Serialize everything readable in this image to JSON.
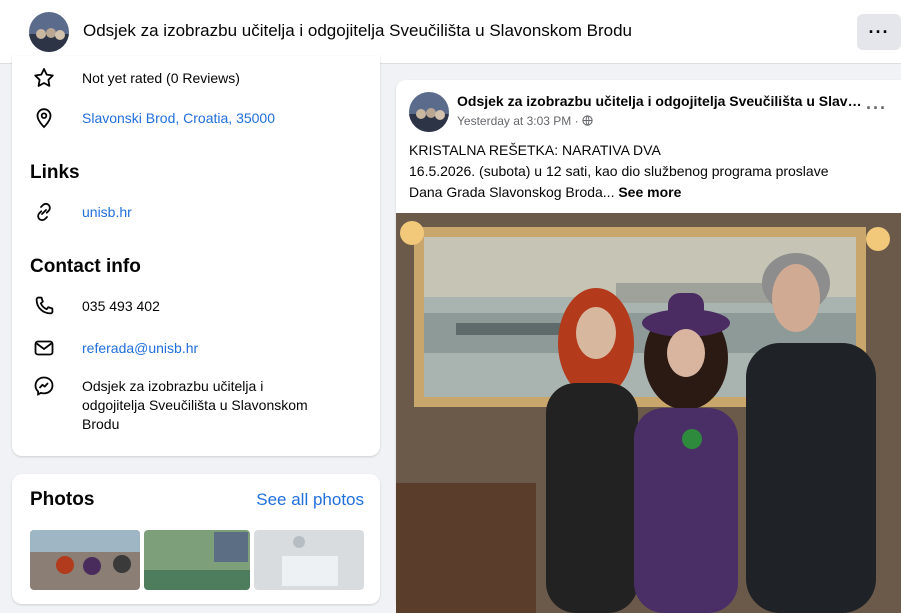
{
  "header": {
    "page_name": "Odsjek za izobrazbu učitelja i odgojitelja Sveučilišta u Slavonskom Brodu",
    "more_label": "···"
  },
  "intro": {
    "rating": "Not yet rated (0 Reviews)",
    "location": "Slavonski Brod, Croatia, 35000",
    "links_heading": "Links",
    "website": "unisb.hr",
    "contact_heading": "Contact info",
    "phone": "035 493 402",
    "email": "referada@unisb.hr",
    "messenger_line1": "Odsjek za izobrazbu učitelja i",
    "messenger_line2": "odgojitelja Sveučilišta u Slavonskom",
    "messenger_line3": "Brodu"
  },
  "photos": {
    "heading": "Photos",
    "see_all": "See all photos"
  },
  "post": {
    "author": "Odsjek za izobrazbu učitelja i odgojitelja Sveučilišta u Slavonskom Brodu",
    "time": "Yesterday at 3:03 PM · ",
    "more_label": "···",
    "line1": "KRISTALNA REŠETKA: NARATIVA DVA",
    "line2": "16.5.2026. (subota) u 12 sati, kao dio službenog programa proslave",
    "line3": "Dana Grada Slavonskog Broda... ",
    "see_more": "See more"
  },
  "icons": {
    "rating": "star-icon",
    "location": "location-pin-icon",
    "website": "link-icon",
    "phone": "phone-icon",
    "email": "mail-icon",
    "messenger": "messenger-icon",
    "privacy": "globe-icon"
  },
  "colors": {
    "link": "#216fdb",
    "background": "#f0f2f5",
    "card": "#ffffff"
  }
}
